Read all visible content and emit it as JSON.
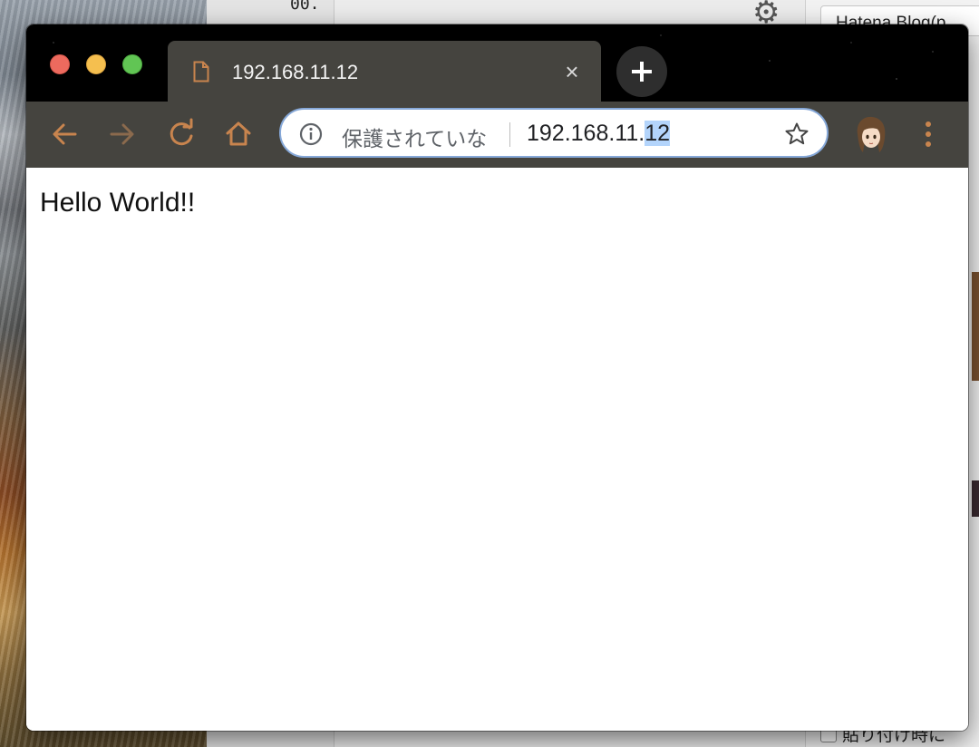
{
  "background_app": {
    "code_snippet": "00.",
    "tab_title": "Hatena Blog(p",
    "footer_checkbox_label": "貼り付け時に"
  },
  "browser": {
    "tab": {
      "title": "192.168.11.12",
      "close_symbol": "×"
    },
    "omnibox": {
      "security_label": "保護されていな",
      "url_prefix": "192.168.11.",
      "url_selected": "12"
    },
    "colors": {
      "accent": "#c8844e",
      "frame": "#45443f",
      "omnibox_border": "#86a8d8",
      "selection": "#b3d4fb"
    }
  },
  "page": {
    "body_text": "Hello World!!"
  }
}
